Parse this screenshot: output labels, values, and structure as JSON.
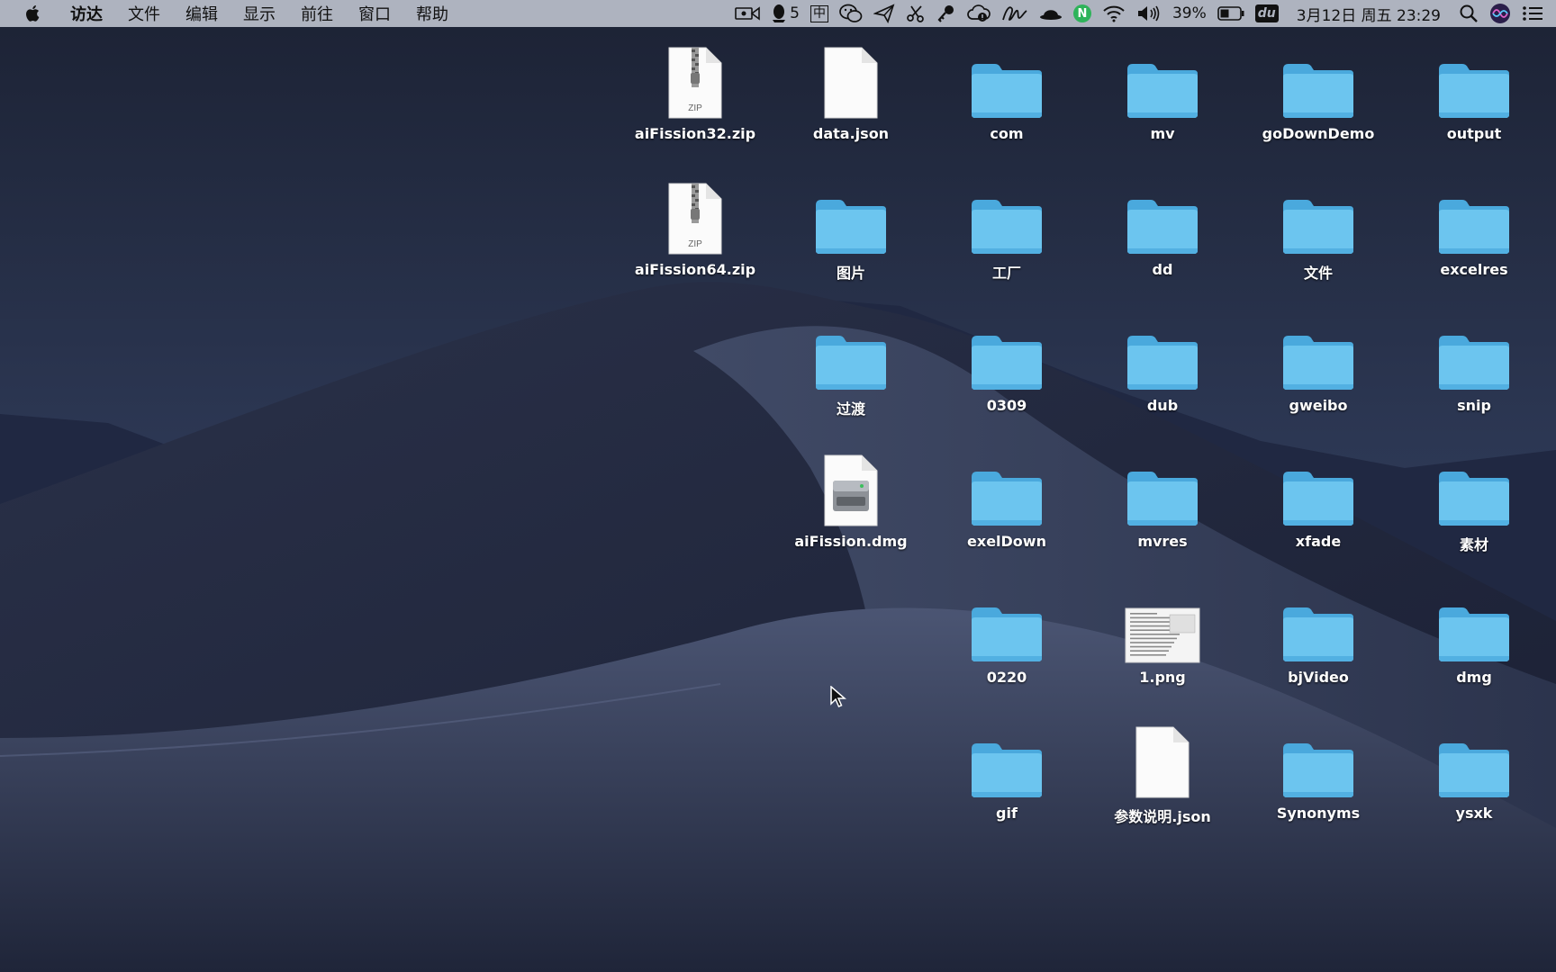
{
  "menubar": {
    "menus": [
      "访达",
      "文件",
      "编辑",
      "显示",
      "前往",
      "窗口",
      "帮助"
    ],
    "status": {
      "qq_count": "5",
      "input_method": "中",
      "battery_percent": "39%",
      "datetime": "3月12日 周五 23:29",
      "baidu_label": "du",
      "evernote_label": "N"
    }
  },
  "desktop": {
    "items": [
      {
        "name": "aiFission32.zip",
        "kind": "zip"
      },
      {
        "name": "data.json",
        "kind": "file"
      },
      {
        "name": "com",
        "kind": "folder"
      },
      {
        "name": "mv",
        "kind": "folder"
      },
      {
        "name": "goDownDemo",
        "kind": "folder"
      },
      {
        "name": "output",
        "kind": "folder"
      },
      {
        "name": "aiFission64.zip",
        "kind": "zip"
      },
      {
        "name": "图片",
        "kind": "folder"
      },
      {
        "name": "工厂",
        "kind": "folder"
      },
      {
        "name": "dd",
        "kind": "folder"
      },
      {
        "name": "文件",
        "kind": "folder"
      },
      {
        "name": "excelres",
        "kind": "folder"
      },
      {
        "name": "过渡",
        "kind": "folder"
      },
      {
        "name": "0309",
        "kind": "folder"
      },
      {
        "name": "dub",
        "kind": "folder"
      },
      {
        "name": "gweibo",
        "kind": "folder"
      },
      {
        "name": "snip",
        "kind": "folder"
      },
      {
        "name": "aiFission.dmg",
        "kind": "dmg"
      },
      {
        "name": "exelDown",
        "kind": "folder"
      },
      {
        "name": "mvres",
        "kind": "folder"
      },
      {
        "name": "xfade",
        "kind": "folder"
      },
      {
        "name": "素材",
        "kind": "folder"
      },
      {
        "name": "0220",
        "kind": "folder"
      },
      {
        "name": "1.png",
        "kind": "image"
      },
      {
        "name": "bjVideo",
        "kind": "folder"
      },
      {
        "name": "dmg",
        "kind": "folder"
      },
      {
        "name": "gif",
        "kind": "folder"
      },
      {
        "name": "参数说明.json",
        "kind": "file"
      },
      {
        "name": "Synonyms",
        "kind": "folder"
      },
      {
        "name": "ysxk",
        "kind": "folder"
      }
    ],
    "zip_badge": "ZIP"
  }
}
